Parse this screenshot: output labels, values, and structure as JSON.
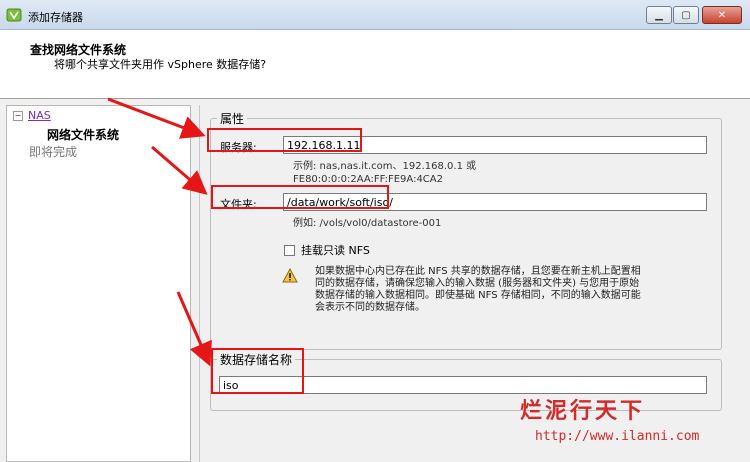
{
  "window": {
    "title": "添加存储器",
    "buttons": {
      "min": "▁",
      "max": "▢",
      "close": "✕"
    }
  },
  "header": {
    "title": "查找网络文件系统",
    "subtitle": "将哪个共享文件夹用作 vSphere 数据存储?"
  },
  "steps": {
    "tree_toggle": "−",
    "nas": "NAS",
    "nfs": "网络文件系统",
    "ready": "即将完成"
  },
  "properties": {
    "legend": "属性",
    "server_label": "服务器:",
    "server_value": "192.168.1.11",
    "server_hint_1": "示例: nas,nas.it.com、192.168.0.1 或",
    "server_hint_2": "FE80:0:0:0:2AA:FF:FE9A:4CA2",
    "folder_label": "文件夹:",
    "folder_value": "/data/work/soft/iso/",
    "folder_hint": "例如: /vols/vol0/datastore-001",
    "readonly_label": "挂载只读 NFS",
    "warning_line1": "如果数据中心内已存在此 NFS 共享的数据存储，且您要在新主机上配置相",
    "warning_line2": "同的数据存储，请确保您输入的输入数据 (服务器和文件夹) 与您用于原始",
    "warning_line3": "数据存储的输入数据相同。即使基础 NFS 存储相同，不同的输入数据可能",
    "warning_line4": "会表示不同的数据存储。"
  },
  "datastore": {
    "legend": "数据存储名称",
    "name_value": "iso"
  },
  "watermark": {
    "text": "烂泥行天下",
    "url": "http://www.ilanni.com"
  },
  "icons": {
    "app": "vsphere-logo-icon",
    "warning": "warning-triangle-icon"
  },
  "colors": {
    "highlight": "#e51616",
    "link": "#7a2cc0",
    "watermark": "#d42a2a"
  }
}
